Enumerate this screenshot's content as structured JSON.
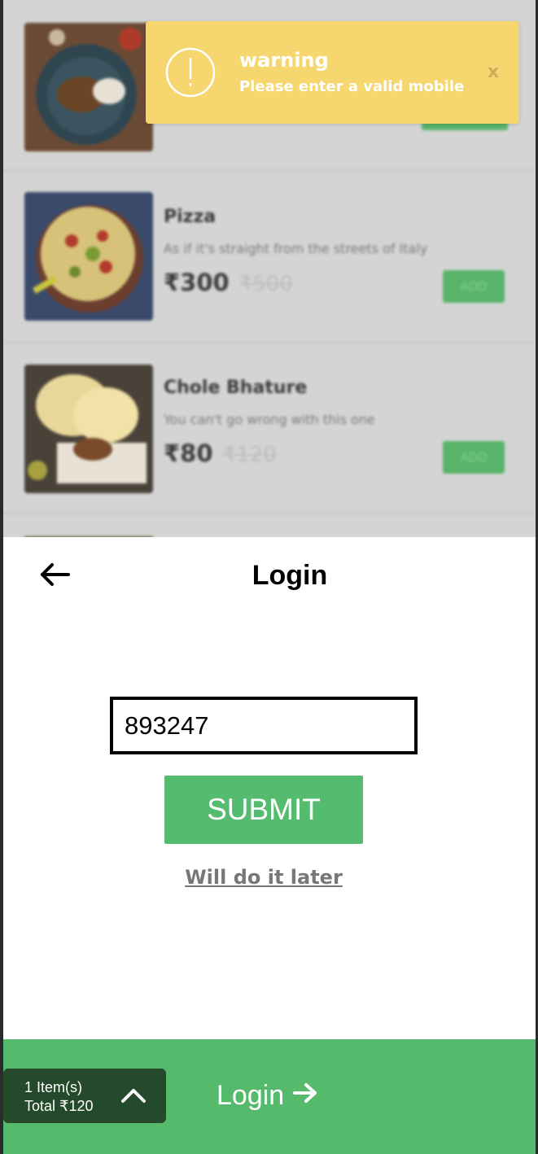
{
  "menu": {
    "items": [
      {
        "name": "",
        "desc": "",
        "price": "",
        "old_price": "",
        "add_label": ""
      },
      {
        "name": "Pizza",
        "desc": "As if it's straight from the streets of Italy",
        "price": "₹300",
        "old_price": "₹500",
        "add_label": "ADD"
      },
      {
        "name": "Chole Bhature",
        "desc": "You can't go wrong with this one",
        "price": "₹80",
        "old_price": "₹120",
        "add_label": "ADD"
      }
    ]
  },
  "toast": {
    "title": "warning",
    "message": "Please enter a valid mobile",
    "close": "x",
    "icon": "exclamation-circle-icon"
  },
  "login": {
    "title": "Login",
    "mobile_value": "893247",
    "submit_label": "SUBMIT",
    "later_label": "Will do it later"
  },
  "bottom_bar": {
    "item_count": "1 Item(s)",
    "total": "Total ₹120",
    "login_label": "Login"
  },
  "colors": {
    "primary_green": "#55bb6e",
    "warning_yellow": "#f6d76f",
    "cart_dark": "#244a2b"
  }
}
